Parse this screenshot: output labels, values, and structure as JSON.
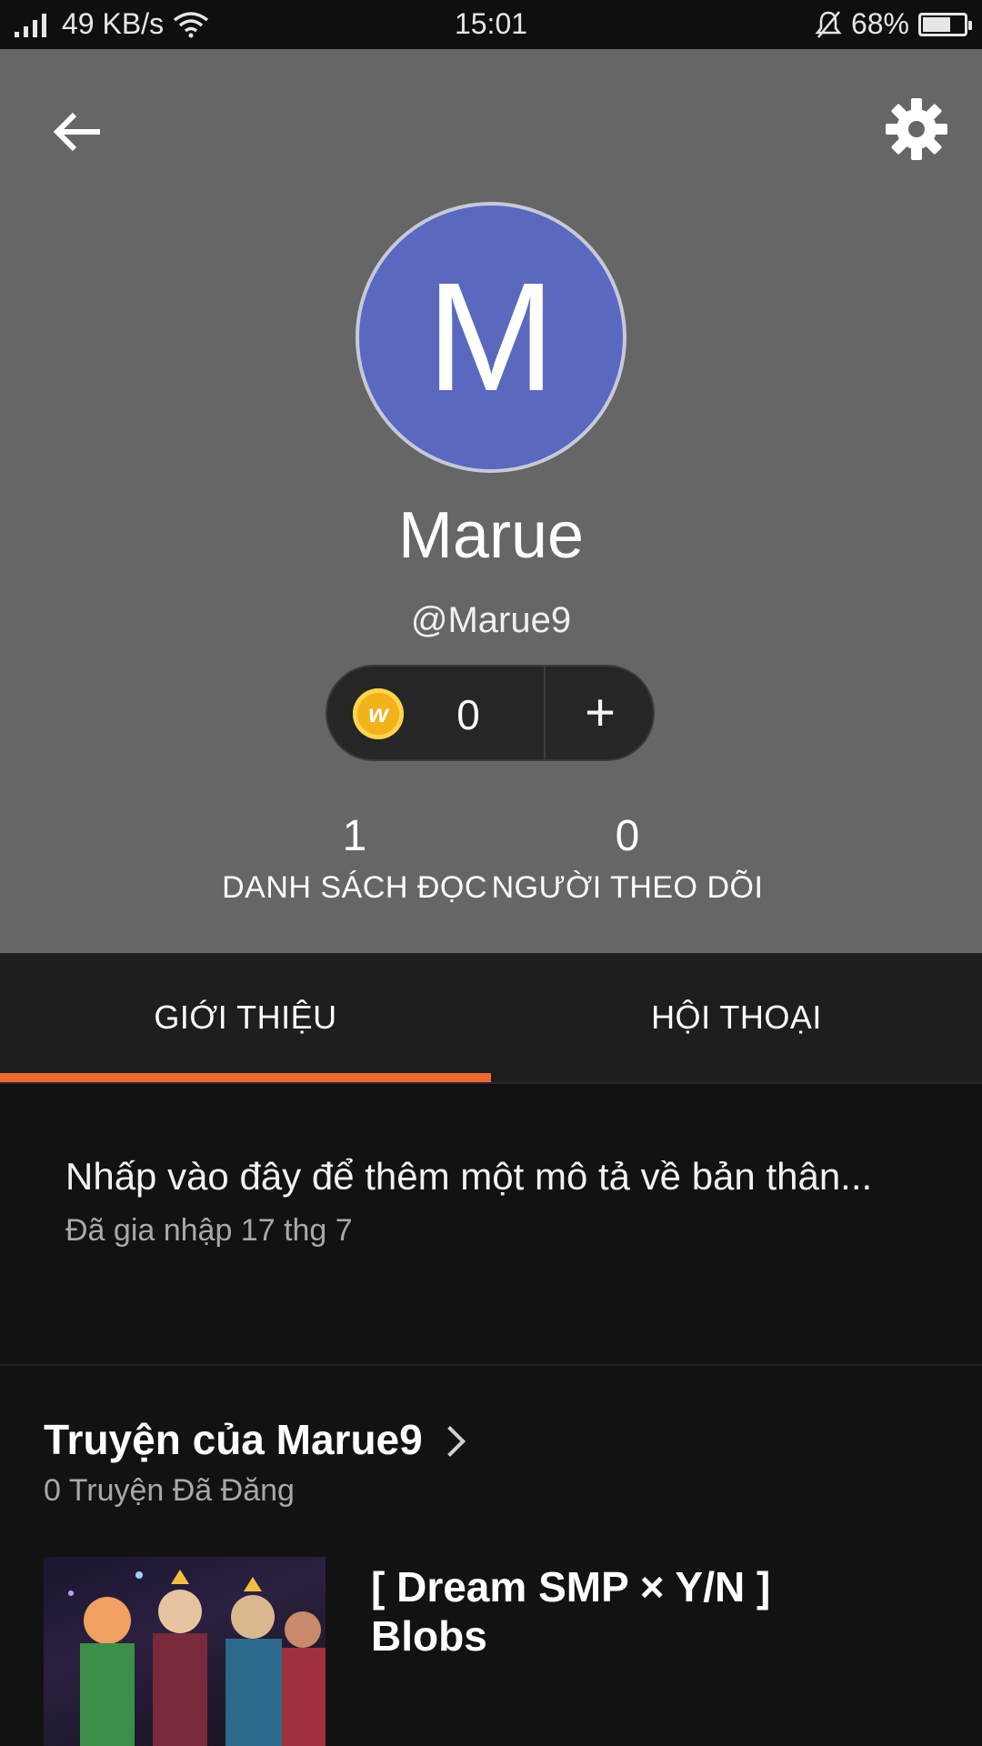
{
  "status_bar": {
    "network_speed": "49 KB/s",
    "time": "15:01",
    "battery_percent": "68%",
    "battery_level": 0.68
  },
  "profile": {
    "avatar_letter": "M",
    "avatar_color": "#5a69bf",
    "display_name": "Marue",
    "username": "@Marue9",
    "coins": "0",
    "add_coins_label": "+"
  },
  "stats": {
    "reading_lists": {
      "value": "1",
      "label": "DANH SÁCH ĐỌC"
    },
    "followers": {
      "value": "0",
      "label": "NGƯỜI THEO DÕI"
    }
  },
  "tabs": [
    {
      "label": "GIỚI THIỆU",
      "active": true
    },
    {
      "label": "HỘI THOẠI",
      "active": false
    }
  ],
  "about": {
    "description_placeholder": "Nhấp vào đây để thêm một mô tả về bản thân...",
    "joined": "Đã gia nhập 17 thg 7"
  },
  "stories": {
    "title": "Truyện của Marue9",
    "count_label": "0 Truyện Đã Đăng",
    "items": [
      {
        "title": "[ Dream SMP × Y/N ] Blobs"
      }
    ]
  },
  "colors": {
    "accent": "#f0682e",
    "header_bg": "#666666"
  }
}
